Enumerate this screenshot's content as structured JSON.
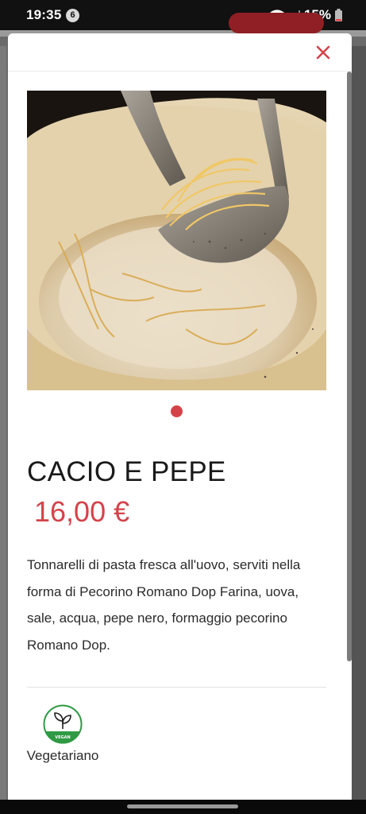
{
  "status_bar": {
    "time": "19:35",
    "notification_count": "6",
    "battery_percent": "15%",
    "icons": [
      "wifi-icon",
      "signal-icon",
      "battery-icon"
    ]
  },
  "modal": {
    "close_icon": "close-icon",
    "carousel": {
      "image": "cacio-e-pepe-photo",
      "active_dot": 1,
      "dot_count": 1
    },
    "title": "CACIO E PEPE",
    "price": "16,00 €",
    "description": "Tonnarelli di pasta fresca all'uovo, serviti nella forma di Pecorino Romano Dop Farina, uova, sale, acqua, pepe nero, formaggio pecorino Romano Dop.",
    "tags": [
      {
        "icon": "vegan-leaf-icon",
        "icon_text": "VEGAN",
        "label": "Vegetariano"
      }
    ]
  },
  "colors": {
    "accent": "#d4434a",
    "text": "#1a1a1a",
    "vegan_green": "#2f9a43"
  }
}
